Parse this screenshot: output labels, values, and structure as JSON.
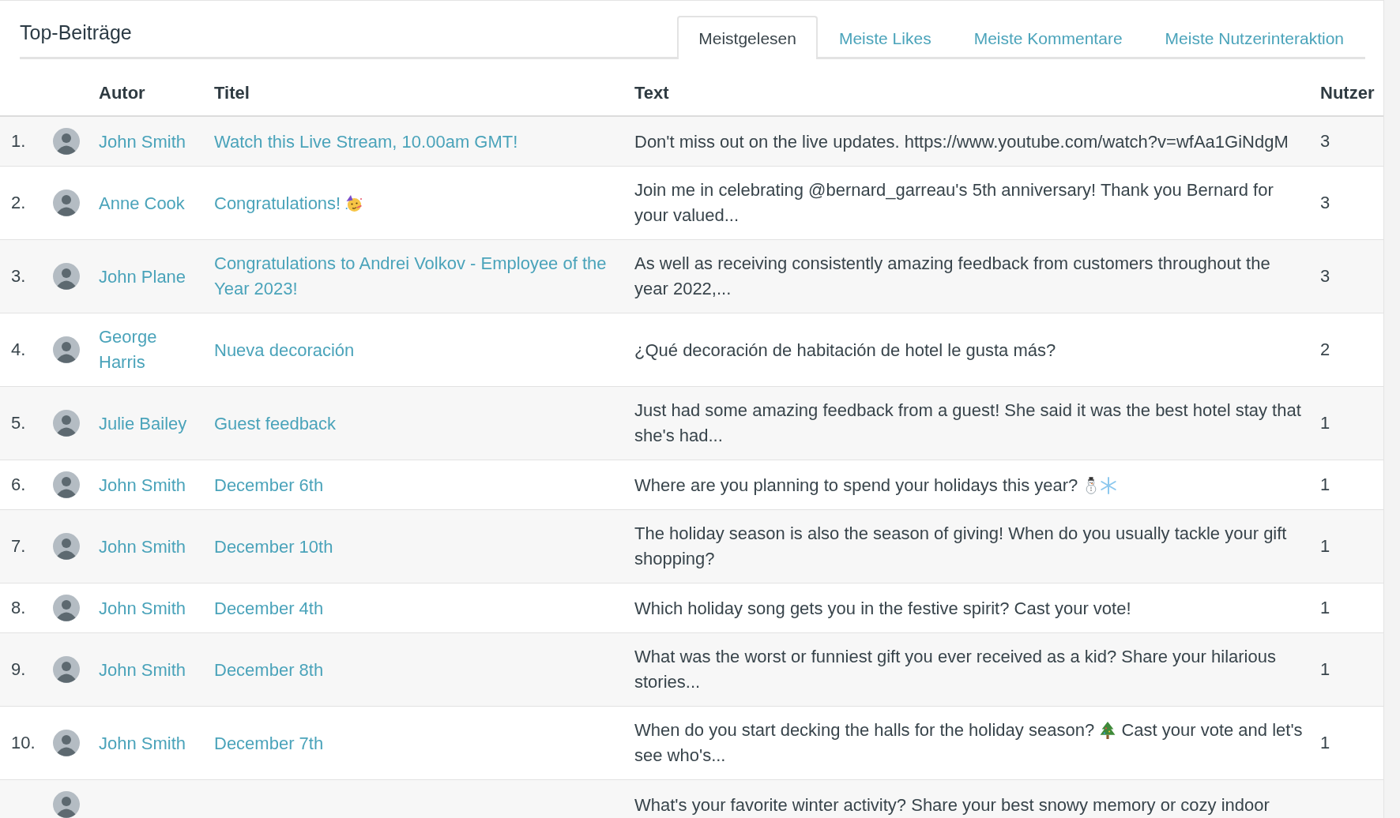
{
  "panel": {
    "title": "Top-Beiträge"
  },
  "tabs": [
    {
      "label": "Meistgelesen",
      "selected": true
    },
    {
      "label": "Meiste Likes",
      "selected": false
    },
    {
      "label": "Meiste Kommentare",
      "selected": false
    },
    {
      "label": "Meiste Nutzerinteraktion",
      "selected": false
    }
  ],
  "table": {
    "columns": {
      "author": "Autor",
      "title": "Titel",
      "text": "Text",
      "users": "Nutzer"
    },
    "rows": [
      {
        "rank": "1.",
        "author": "John Smith",
        "title": "Watch this Live Stream, 10.00am GMT!",
        "text": "Don't miss out on the live updates. https://www.youtube.com/watch?v=wfAa1GiNdgM",
        "users": "3"
      },
      {
        "rank": "2.",
        "author": "Anne Cook",
        "title": [
          {
            "kind": "text",
            "text": "Congratulations!"
          },
          {
            "kind": "party-face"
          }
        ],
        "text": "Join me in celebrating @bernard_garreau's 5th anniversary! Thank you Bernard for your valued...",
        "users": "3"
      },
      {
        "rank": "3.",
        "author": "John Plane",
        "title": "Congratulations to Andrei Volkov - Employee of the Year 2023!",
        "text": "As well as receiving consistently amazing feedback from customers throughout the year 2022,...",
        "users": "3"
      },
      {
        "rank": "4.",
        "author": "George Harris",
        "title": "Nueva decoración",
        "text": "¿Qué decoración de habitación de hotel le gusta más?",
        "users": "2"
      },
      {
        "rank": "5.",
        "author": "Julie Bailey",
        "title": "Guest feedback",
        "text": "Just had some amazing feedback from a guest! She said it was the best hotel stay that she's had...",
        "users": "1"
      },
      {
        "rank": "6.",
        "author": "John Smith",
        "title": "December 6th",
        "text": [
          {
            "kind": "text",
            "text": "Where are you planning to spend your holidays this year?"
          },
          {
            "kind": "snowman"
          },
          {
            "kind": "snowflake"
          }
        ],
        "users": "1"
      },
      {
        "rank": "7.",
        "author": "John Smith",
        "title": "December 10th",
        "text": "The holiday season is also the season of giving! When do you usually tackle your gift shopping?",
        "users": "1"
      },
      {
        "rank": "8.",
        "author": "John Smith",
        "title": "December 4th",
        "text": "Which holiday song gets you in the festive spirit? Cast your vote!",
        "users": "1"
      },
      {
        "rank": "9.",
        "author": "John Smith",
        "title": "December 8th",
        "text": "What was the worst or funniest gift you ever received as a kid? Share your hilarious stories...",
        "users": "1"
      },
      {
        "rank": "10.",
        "author": "John Smith",
        "title": "December 7th",
        "text": [
          {
            "kind": "text",
            "text": "When do you start decking the halls for the holiday season?"
          },
          {
            "kind": "christmas-tree"
          },
          {
            "kind": "text",
            "text": "Cast your vote and let's see who's..."
          }
        ],
        "users": "1"
      },
      {
        "text": "What's your favorite winter activity? Share your best snowy memory or cozy indoor"
      }
    ]
  }
}
